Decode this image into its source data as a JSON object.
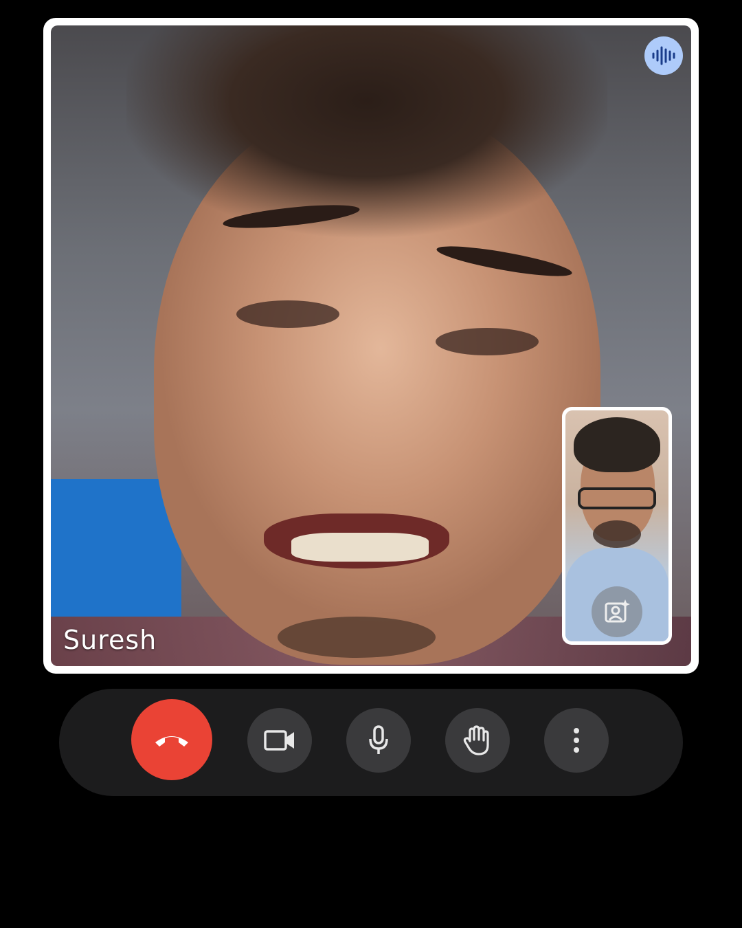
{
  "call": {
    "remote_participant": {
      "name": "Suresh"
    },
    "icons": {
      "speaking": "audio-waveform-icon",
      "effects": "add-photo-effects-icon",
      "end_call": "phone-hangup-icon",
      "camera": "videocam-icon",
      "mic": "mic-icon",
      "raise_hand": "hand-icon",
      "more": "more-vert-icon"
    },
    "colors": {
      "end_call": "#ea4335",
      "control_bg": "#3a3a3c",
      "bar_bg": "#1c1c1d",
      "speaking_badge": "#aecbfa"
    }
  }
}
